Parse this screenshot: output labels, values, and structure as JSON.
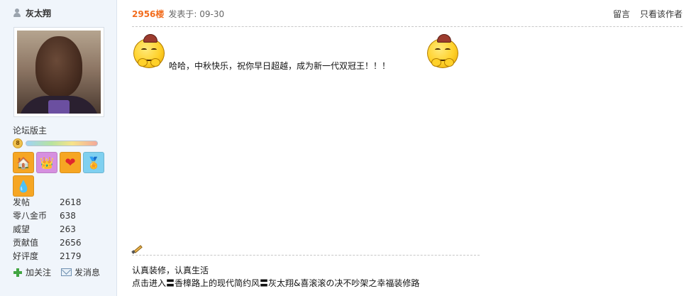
{
  "user": {
    "name": "灰太翔",
    "role": "论坛版主",
    "level_fraction": 1.0,
    "medals": [
      {
        "icon": "house-icon",
        "glyph": "🏠",
        "color": "#f6a623"
      },
      {
        "icon": "crown-icon",
        "glyph": "👑",
        "color": "#d68fe0"
      },
      {
        "icon": "heart-icon",
        "glyph": "❤",
        "color": "#f6a623"
      },
      {
        "icon": "medal-icon",
        "glyph": "🏅",
        "color": "#7fd0f0"
      },
      {
        "icon": "droplet-icon",
        "glyph": "💧",
        "color": "#f6a623"
      }
    ],
    "stats": [
      {
        "label": "发帖",
        "value": "2618"
      },
      {
        "label": "零八金币",
        "value": "638"
      },
      {
        "label": "威望",
        "value": "263"
      },
      {
        "label": "贡献值",
        "value": "2656"
      },
      {
        "label": "好评度",
        "value": "2179"
      }
    ],
    "actions": {
      "follow": "加关注",
      "message": "发消息"
    }
  },
  "post": {
    "floor": "2956楼",
    "posted": "发表于: 09-30",
    "links": {
      "reply": "留言",
      "author_only": "只看该作者"
    },
    "body": "哈哈，中秋快乐，祝你早日超越，成为新一代双冠王！！！",
    "signature": {
      "line1": "认真装修，认真生活",
      "line2": "点击进入〓香樟路上的现代简约风〓灰太翔&喜滚滚の决不吵架之幸福装修路"
    }
  },
  "colors": {
    "floor": "#f26c1d",
    "sidebar_bg": "#f0f5fb"
  }
}
